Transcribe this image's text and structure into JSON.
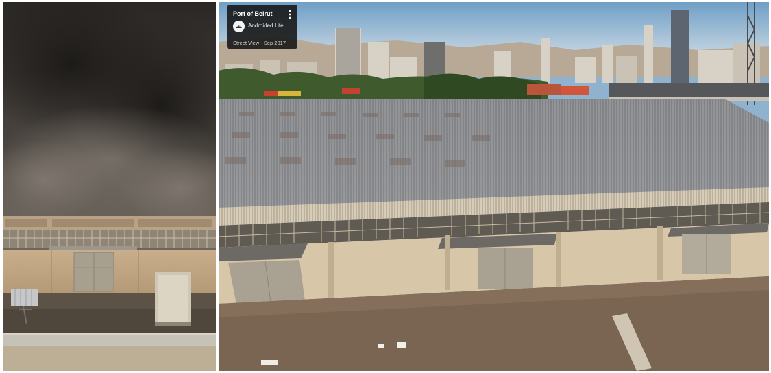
{
  "photos": {
    "left": {
      "label": "smoke-over-warehouse-photo"
    },
    "right": {
      "label": "street-view-warehouse-photo"
    }
  },
  "street_view_card": {
    "title": "Port of Beirut",
    "author": "Androided Life",
    "date": "Street View - Sep 2017",
    "icons": {
      "menu": "more-vert-icon",
      "avatar": "avatar-icon"
    }
  }
}
